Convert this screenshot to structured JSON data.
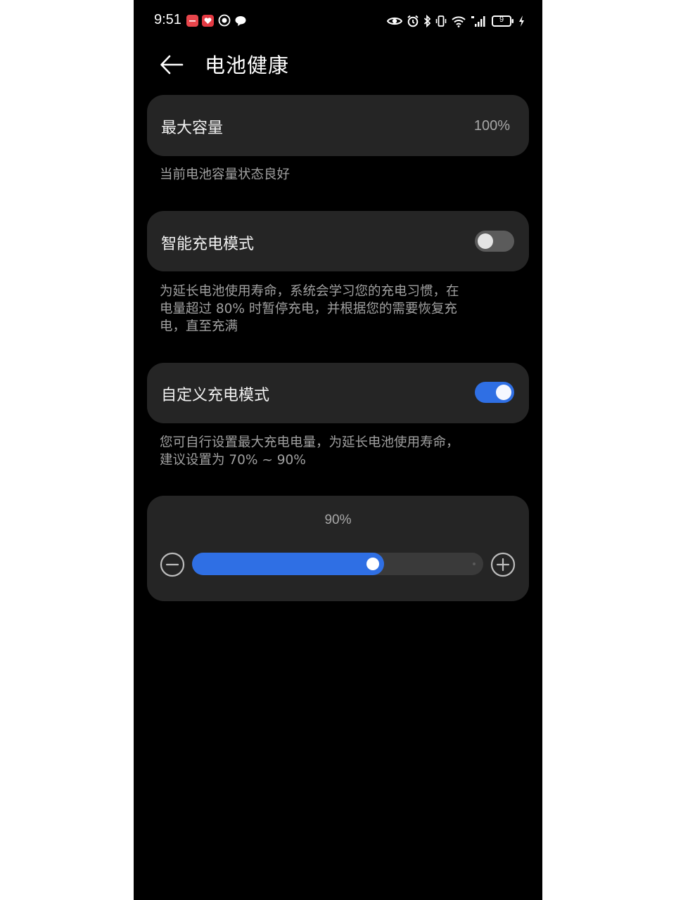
{
  "status_bar": {
    "time": "9:51",
    "battery_level": "9"
  },
  "header": {
    "title": "电池健康"
  },
  "max_capacity": {
    "label": "最大容量",
    "value": "100%",
    "description": "当前电池容量状态良好"
  },
  "smart_charging": {
    "label": "智能充电模式",
    "enabled": false,
    "description_lines": [
      "为延长电池使用寿命，系统会学习您的充电习惯，在",
      "电量超过 80% 时暂停充电，并根据您的需要恢复充",
      "电，直至充满"
    ]
  },
  "custom_charging": {
    "label": "自定义充电模式",
    "enabled": true,
    "description_lines": [
      "您可自行设置最大充电电量，为延长电池使用寿命，",
      "建议设置为 70% ~ 90%"
    ]
  },
  "charge_limit": {
    "value_label": "90%",
    "fill_fraction": 0.66
  },
  "colors": {
    "background": "#000000",
    "card": "#252525",
    "accent": "#2f6fe4",
    "secondary_text": "#a0a0a0"
  },
  "icons": {
    "back": "arrow-left-icon",
    "decrease": "minus-circle-icon",
    "increase": "plus-circle-icon"
  }
}
